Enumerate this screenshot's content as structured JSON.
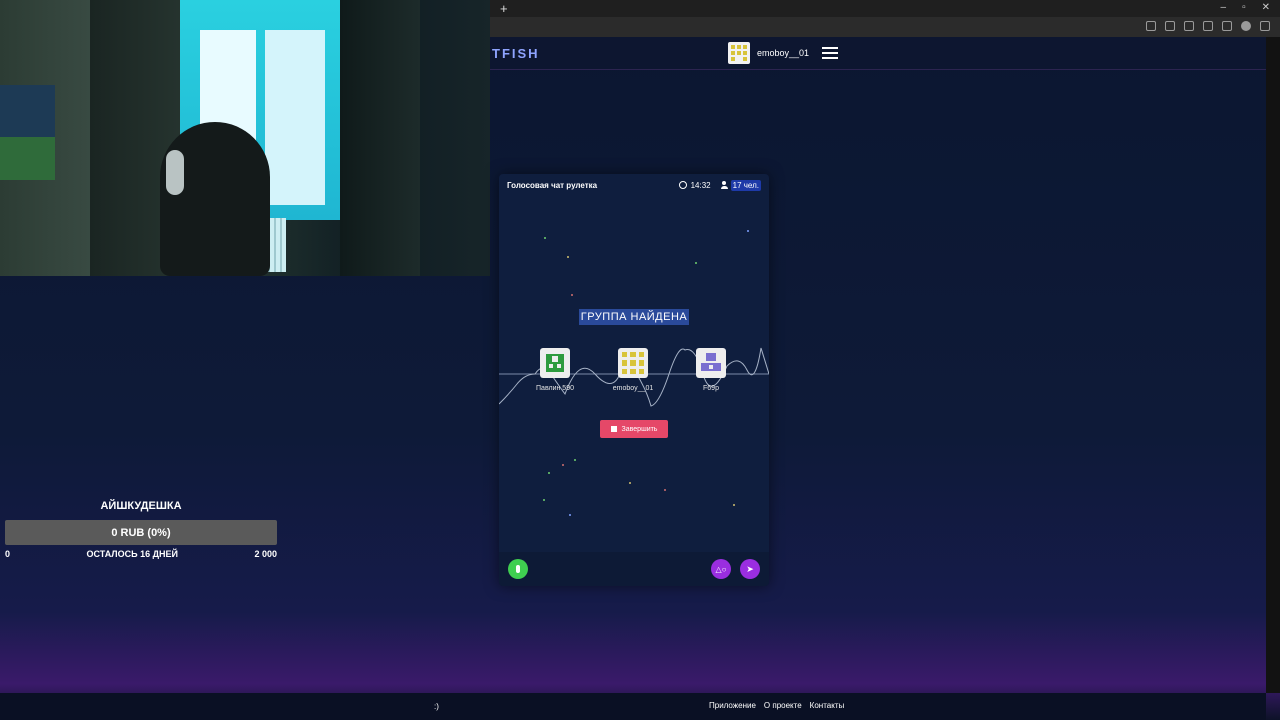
{
  "browser": {
    "new_tab": "+",
    "window_controls": [
      "–",
      "▫",
      "✕"
    ]
  },
  "header": {
    "logo": "TFISH",
    "username": "emoboy__01"
  },
  "donation": {
    "title": "АЙШКУДЕШКА",
    "amount": "0 RUB (0%)",
    "min": "0",
    "remaining": "ОСТАЛОСЬ 16 ДНЕЙ",
    "max": "2 000"
  },
  "chat": {
    "title": "Голосовая чат рулетка",
    "time": "14:32",
    "online": "17 чел.",
    "status": "ГРУППА НАЙДЕНА",
    "members": [
      {
        "name": "Павлин 590",
        "color": "#2e9b3e"
      },
      {
        "name": "emoboy__01",
        "color": "#d8c43a"
      },
      {
        "name": "F69p",
        "color": "#7a6fd0"
      }
    ],
    "end_button": "Завершить",
    "game_icon": "gamepad-icon",
    "send_icon": "send-icon"
  },
  "footer": {
    "smile": ":)",
    "links": [
      "Приложение",
      "О проекте",
      "Контакты"
    ]
  },
  "colors": {
    "accent": "#9a2ee0",
    "end": "#e54868",
    "mic": "#3fcf50"
  }
}
